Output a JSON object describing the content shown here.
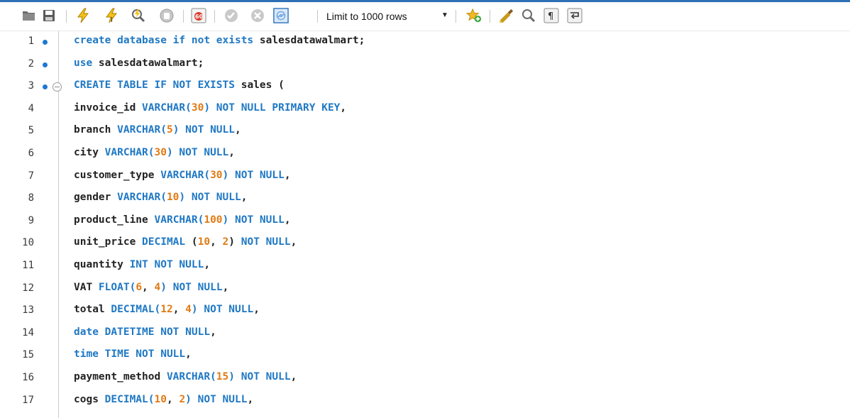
{
  "toolbar": {
    "limit_label": "Limit to 1000 rows",
    "icons": [
      "open-folder-icon",
      "save-icon",
      "execute-icon",
      "execute-current-icon",
      "explain-icon",
      "stop-icon",
      "toggle-continue-on-error-icon",
      "commit-icon",
      "rollback-icon",
      "autocommit-icon",
      "limit-rows-select",
      "add-snippet-icon",
      "beautify-icon",
      "find-icon",
      "invisible-chars-icon",
      "wrap-lines-icon"
    ]
  },
  "colors": {
    "keyword": "#1f78c4",
    "number": "#e07b14",
    "text": "#222222",
    "marker": "#1f78d1"
  },
  "editor": {
    "lines": [
      {
        "n": "1",
        "marker": true,
        "fold": false,
        "tokens": [
          [
            "kw",
            "create database if not exists"
          ],
          [
            "id",
            " salesdatawalmart;"
          ]
        ]
      },
      {
        "n": "2",
        "marker": true,
        "fold": false,
        "tokens": [
          [
            "kw",
            "use"
          ],
          [
            "id",
            " salesdatawalmart;"
          ]
        ]
      },
      {
        "n": "3",
        "marker": true,
        "fold": true,
        "tokens": [
          [
            "kw",
            "CREATE TABLE IF NOT EXISTS"
          ],
          [
            "id",
            " sales ("
          ]
        ]
      },
      {
        "n": "4",
        "marker": false,
        "fold": false,
        "tokens": [
          [
            "id",
            "invoice_id "
          ],
          [
            "kw",
            "VARCHAR("
          ],
          [
            "num",
            "30"
          ],
          [
            "kw",
            ")"
          ],
          [
            "kw",
            " NOT NULL PRIMARY KEY"
          ],
          [
            "id",
            ","
          ]
        ]
      },
      {
        "n": "5",
        "marker": false,
        "fold": false,
        "tokens": [
          [
            "id",
            "branch "
          ],
          [
            "kw",
            "VARCHAR("
          ],
          [
            "num",
            "5"
          ],
          [
            "kw",
            ")"
          ],
          [
            "kw",
            " NOT NULL"
          ],
          [
            "id",
            ","
          ]
        ]
      },
      {
        "n": "6",
        "marker": false,
        "fold": false,
        "tokens": [
          [
            "id",
            "city "
          ],
          [
            "kw",
            "VARCHAR("
          ],
          [
            "num",
            "30"
          ],
          [
            "kw",
            ")"
          ],
          [
            "kw",
            " NOT NULL"
          ],
          [
            "id",
            ","
          ]
        ]
      },
      {
        "n": "7",
        "marker": false,
        "fold": false,
        "tokens": [
          [
            "id",
            "customer_type "
          ],
          [
            "kw",
            "VARCHAR("
          ],
          [
            "num",
            "30"
          ],
          [
            "kw",
            ")"
          ],
          [
            "kw",
            " NOT NULL"
          ],
          [
            "id",
            ","
          ]
        ]
      },
      {
        "n": "8",
        "marker": false,
        "fold": false,
        "tokens": [
          [
            "id",
            "gender "
          ],
          [
            "kw",
            "VARCHAR("
          ],
          [
            "num",
            "10"
          ],
          [
            "kw",
            ")"
          ],
          [
            "kw",
            " NOT NULL"
          ],
          [
            "id",
            ","
          ]
        ]
      },
      {
        "n": "9",
        "marker": false,
        "fold": false,
        "tokens": [
          [
            "id",
            "product_line "
          ],
          [
            "kw",
            "VARCHAR("
          ],
          [
            "num",
            "100"
          ],
          [
            "kw",
            ")"
          ],
          [
            "kw",
            " NOT NULL"
          ],
          [
            "id",
            ","
          ]
        ]
      },
      {
        "n": "10",
        "marker": false,
        "fold": false,
        "tokens": [
          [
            "id",
            "unit_price "
          ],
          [
            "kw",
            "DECIMAL"
          ],
          [
            "id",
            " ("
          ],
          [
            "num",
            "10"
          ],
          [
            "id",
            ", "
          ],
          [
            "num",
            "2"
          ],
          [
            "id",
            ")"
          ],
          [
            "kw",
            " NOT NULL"
          ],
          [
            "id",
            ","
          ]
        ]
      },
      {
        "n": "11",
        "marker": false,
        "fold": false,
        "tokens": [
          [
            "id",
            "quantity "
          ],
          [
            "kw",
            "INT NOT NULL"
          ],
          [
            "id",
            ","
          ]
        ]
      },
      {
        "n": "12",
        "marker": false,
        "fold": false,
        "tokens": [
          [
            "id",
            "VAT "
          ],
          [
            "kw",
            "FLOAT("
          ],
          [
            "num",
            "6"
          ],
          [
            "id",
            ", "
          ],
          [
            "num",
            "4"
          ],
          [
            "kw",
            ")"
          ],
          [
            "kw",
            " NOT NULL"
          ],
          [
            "id",
            ","
          ]
        ]
      },
      {
        "n": "13",
        "marker": false,
        "fold": false,
        "tokens": [
          [
            "id",
            "total "
          ],
          [
            "kw",
            "DECIMAL("
          ],
          [
            "num",
            "12"
          ],
          [
            "id",
            ", "
          ],
          [
            "num",
            "4"
          ],
          [
            "kw",
            ")"
          ],
          [
            "kw",
            " NOT NULL"
          ],
          [
            "id",
            ","
          ]
        ]
      },
      {
        "n": "14",
        "marker": false,
        "fold": false,
        "tokens": [
          [
            "kw",
            "date DATETIME NOT NULL"
          ],
          [
            "id",
            ","
          ]
        ]
      },
      {
        "n": "15",
        "marker": false,
        "fold": false,
        "tokens": [
          [
            "kw",
            "time TIME NOT NULL"
          ],
          [
            "id",
            ","
          ]
        ]
      },
      {
        "n": "16",
        "marker": false,
        "fold": false,
        "tokens": [
          [
            "id",
            "payment_method "
          ],
          [
            "kw",
            "VARCHAR("
          ],
          [
            "num",
            "15"
          ],
          [
            "kw",
            ")"
          ],
          [
            "kw",
            " NOT NULL"
          ],
          [
            "id",
            ","
          ]
        ]
      },
      {
        "n": "17",
        "marker": false,
        "fold": false,
        "tokens": [
          [
            "id",
            "cogs "
          ],
          [
            "kw",
            "DECIMAL("
          ],
          [
            "num",
            "10"
          ],
          [
            "id",
            ", "
          ],
          [
            "num",
            "2"
          ],
          [
            "kw",
            ")"
          ],
          [
            "kw",
            " NOT NULL"
          ],
          [
            "id",
            ","
          ]
        ]
      }
    ]
  }
}
